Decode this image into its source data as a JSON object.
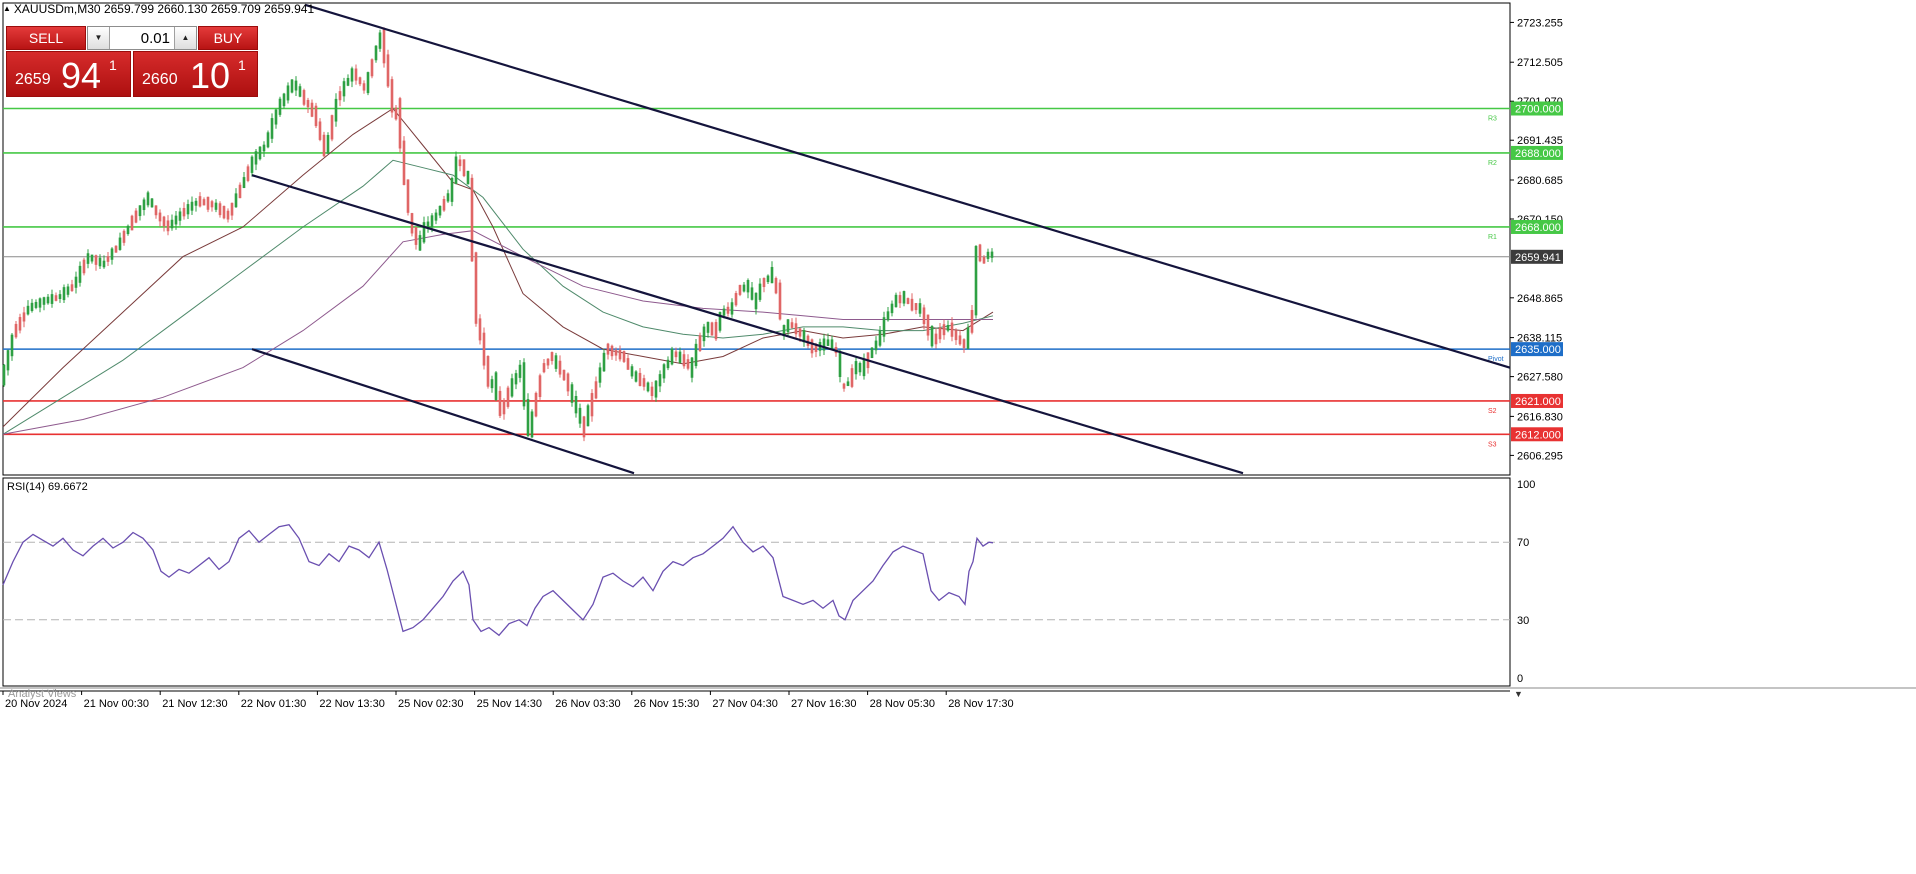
{
  "symbol": {
    "header": "XAUUSDm,M30  2659.799 2660.130 2659.709 2659.941",
    "collapse_icon": "triangle-up-icon"
  },
  "trade_panel": {
    "sell_label": "SELL",
    "buy_label": "BUY",
    "lot_value": "0.01",
    "lot_down_icon": "triangle-down-icon",
    "lot_up_icon": "triangle-up-icon",
    "bid_prefix": "2659",
    "bid_big": "94",
    "bid_sup": "1",
    "ask_prefix": "2660",
    "ask_big": "10",
    "ask_sup": "1",
    "color": "#c81e1e"
  },
  "chart_data": {
    "type": "candlestick",
    "symbol": "XAUUSDm",
    "timeframe": "M30",
    "price_axis": {
      "ylim": [
        2601.0,
        2728.5
      ],
      "ticks": [
        2723.255,
        2712.505,
        2701.97,
        2691.435,
        2680.685,
        2670.15,
        2659.941,
        2648.865,
        2638.115,
        2627.58,
        2616.83,
        2606.295
      ]
    },
    "current_price": {
      "value": 2659.941,
      "label": "2659.941",
      "color": "#3c3c3c"
    },
    "time_labels": [
      "20 Nov 2024",
      "21 Nov 00:30",
      "21 Nov 12:30",
      "22 Nov 01:30",
      "22 Nov 13:30",
      "25 Nov 02:30",
      "25 Nov 14:30",
      "26 Nov 03:30",
      "26 Nov 15:30",
      "27 Nov 04:30",
      "27 Nov 16:30",
      "28 Nov 05:30",
      "28 Nov 17:30"
    ],
    "close_path": [
      [
        0,
        2628
      ],
      [
        12,
        2640
      ],
      [
        25,
        2646
      ],
      [
        40,
        2648
      ],
      [
        55,
        2649
      ],
      [
        70,
        2652
      ],
      [
        85,
        2660
      ],
      [
        100,
        2658
      ],
      [
        115,
        2663
      ],
      [
        130,
        2670
      ],
      [
        145,
        2676
      ],
      [
        155,
        2671
      ],
      [
        165,
        2668
      ],
      [
        180,
        2672
      ],
      [
        195,
        2675
      ],
      [
        210,
        2674
      ],
      [
        225,
        2671
      ],
      [
        240,
        2680
      ],
      [
        250,
        2686
      ],
      [
        262,
        2690
      ],
      [
        275,
        2700
      ],
      [
        290,
        2707
      ],
      [
        300,
        2703
      ],
      [
        312,
        2698
      ],
      [
        322,
        2688
      ],
      [
        335,
        2703
      ],
      [
        350,
        2710
      ],
      [
        362,
        2705
      ],
      [
        372,
        2715
      ],
      [
        378,
        2720
      ],
      [
        383,
        2712
      ],
      [
        390,
        2700
      ],
      [
        396,
        2696
      ],
      [
        402,
        2680
      ],
      [
        408,
        2669
      ],
      [
        415,
        2663
      ],
      [
        422,
        2668
      ],
      [
        430,
        2670
      ],
      [
        440,
        2674
      ],
      [
        448,
        2678
      ],
      [
        454,
        2686
      ],
      [
        460,
        2684
      ],
      [
        466,
        2680
      ],
      [
        470,
        2660
      ],
      [
        474,
        2643
      ],
      [
        480,
        2635
      ],
      [
        486,
        2626
      ],
      [
        492,
        2625
      ],
      [
        498,
        2618
      ],
      [
        504,
        2622
      ],
      [
        510,
        2626
      ],
      [
        518,
        2630
      ],
      [
        526,
        2612
      ],
      [
        532,
        2620
      ],
      [
        540,
        2630
      ],
      [
        548,
        2633
      ],
      [
        556,
        2630
      ],
      [
        564,
        2626
      ],
      [
        572,
        2620
      ],
      [
        580,
        2614
      ],
      [
        588,
        2620
      ],
      [
        596,
        2628
      ],
      [
        604,
        2635
      ],
      [
        612,
        2634
      ],
      [
        620,
        2633
      ],
      [
        630,
        2628
      ],
      [
        640,
        2626
      ],
      [
        650,
        2623
      ],
      [
        660,
        2629
      ],
      [
        670,
        2634
      ],
      [
        680,
        2632
      ],
      [
        688,
        2630
      ],
      [
        695,
        2636
      ],
      [
        703,
        2641
      ],
      [
        712,
        2640
      ],
      [
        720,
        2645
      ],
      [
        728,
        2646
      ],
      [
        736,
        2651
      ],
      [
        744,
        2652
      ],
      [
        752,
        2648
      ],
      [
        760,
        2653
      ],
      [
        768,
        2655
      ],
      [
        775,
        2650
      ],
      [
        780,
        2640
      ],
      [
        786,
        2642
      ],
      [
        794,
        2640
      ],
      [
        802,
        2638
      ],
      [
        810,
        2635
      ],
      [
        818,
        2636
      ],
      [
        826,
        2637
      ],
      [
        834,
        2634
      ],
      [
        840,
        2625
      ],
      [
        846,
        2626
      ],
      [
        852,
        2630
      ],
      [
        860,
        2630
      ],
      [
        868,
        2634
      ],
      [
        876,
        2638
      ],
      [
        884,
        2644
      ],
      [
        892,
        2648
      ],
      [
        900,
        2649
      ],
      [
        908,
        2647
      ],
      [
        916,
        2646
      ],
      [
        922,
        2643
      ],
      [
        930,
        2637
      ],
      [
        938,
        2640
      ],
      [
        946,
        2641
      ],
      [
        954,
        2638
      ],
      [
        962,
        2636
      ],
      [
        966,
        2640
      ],
      [
        970,
        2645
      ],
      [
        974,
        2662
      ],
      [
        980,
        2659
      ],
      [
        986,
        2661
      ],
      [
        990,
        2660
      ]
    ],
    "moving_averages": [
      {
        "color": "#7a3b3b",
        "points": [
          [
            0,
            2614
          ],
          [
            60,
            2630
          ],
          [
            120,
            2645
          ],
          [
            180,
            2660
          ],
          [
            240,
            2668
          ],
          [
            300,
            2682
          ],
          [
            350,
            2693
          ],
          [
            390,
            2700
          ],
          [
            420,
            2690
          ],
          [
            450,
            2680
          ],
          [
            470,
            2678
          ],
          [
            490,
            2668
          ],
          [
            520,
            2650
          ],
          [
            560,
            2641
          ],
          [
            600,
            2635
          ],
          [
            640,
            2633
          ],
          [
            680,
            2631
          ],
          [
            720,
            2633
          ],
          [
            760,
            2638
          ],
          [
            800,
            2640
          ],
          [
            840,
            2638
          ],
          [
            880,
            2639
          ],
          [
            920,
            2641
          ],
          [
            960,
            2640
          ],
          [
            990,
            2645
          ]
        ]
      },
      {
        "color": "#4f8a6b",
        "points": [
          [
            0,
            2612
          ],
          [
            60,
            2622
          ],
          [
            120,
            2632
          ],
          [
            180,
            2644
          ],
          [
            240,
            2656
          ],
          [
            300,
            2668
          ],
          [
            360,
            2679
          ],
          [
            390,
            2686
          ],
          [
            420,
            2684
          ],
          [
            450,
            2682
          ],
          [
            480,
            2676
          ],
          [
            520,
            2662
          ],
          [
            560,
            2652
          ],
          [
            600,
            2645
          ],
          [
            640,
            2641
          ],
          [
            680,
            2639
          ],
          [
            720,
            2638
          ],
          [
            760,
            2639
          ],
          [
            800,
            2641
          ],
          [
            840,
            2641
          ],
          [
            880,
            2640
          ],
          [
            920,
            2640
          ],
          [
            960,
            2642
          ],
          [
            990,
            2644
          ]
        ]
      },
      {
        "color": "#8e5a8e",
        "points": [
          [
            0,
            2612
          ],
          [
            80,
            2616
          ],
          [
            160,
            2622
          ],
          [
            240,
            2630
          ],
          [
            300,
            2640
          ],
          [
            360,
            2652
          ],
          [
            400,
            2664
          ],
          [
            440,
            2666
          ],
          [
            470,
            2667
          ],
          [
            520,
            2660
          ],
          [
            580,
            2652
          ],
          [
            640,
            2648
          ],
          [
            700,
            2646
          ],
          [
            760,
            2645
          ],
          [
            800,
            2644
          ],
          [
            840,
            2643
          ],
          [
            880,
            2643
          ],
          [
            920,
            2643
          ],
          [
            960,
            2643
          ],
          [
            990,
            2643
          ]
        ]
      }
    ],
    "horizontal_levels": [
      {
        "value": 2700.0,
        "label": "2700.000",
        "tag": "R3",
        "color": "#46c846"
      },
      {
        "value": 2688.0,
        "label": "2688.000",
        "tag": "R2",
        "color": "#46c846"
      },
      {
        "value": 2668.0,
        "label": "2668.000",
        "tag": "R1",
        "color": "#46c846"
      },
      {
        "value": 2635.0,
        "label": "2635.000",
        "tag": "Pivot",
        "color": "#1e6ec8"
      },
      {
        "value": 2621.0,
        "label": "2621.000",
        "tag": "S2",
        "color": "#e83232"
      },
      {
        "value": 2612.0,
        "label": "2612.000",
        "tag": "S3",
        "color": "#e83232"
      }
    ],
    "trendlines": [
      {
        "color": "#14143c",
        "from": [
          305,
          2728.0
        ],
        "to": [
          1510,
          2630.0
        ]
      },
      {
        "color": "#14143c",
        "from": [
          252,
          2682.0
        ],
        "to": [
          1243,
          2601.5
        ]
      },
      {
        "color": "#14143c",
        "from": [
          252,
          2635.0
        ],
        "to": [
          634,
          2601.5
        ]
      }
    ],
    "candle_colors": {
      "bull": "#2ea043",
      "bear": "#e06666"
    },
    "rsi": {
      "label": "RSI(14) 69.6672",
      "ylim": [
        0,
        100
      ],
      "levels": [
        70,
        30
      ],
      "tick_labels": [
        "100",
        "70",
        "30",
        "0"
      ],
      "color": "#6a4fb0",
      "values": [
        [
          0,
          48
        ],
        [
          10,
          60
        ],
        [
          20,
          70
        ],
        [
          30,
          74
        ],
        [
          40,
          71
        ],
        [
          50,
          68
        ],
        [
          60,
          72
        ],
        [
          70,
          66
        ],
        [
          80,
          63
        ],
        [
          90,
          68
        ],
        [
          100,
          72
        ],
        [
          110,
          67
        ],
        [
          120,
          70
        ],
        [
          130,
          75
        ],
        [
          140,
          72
        ],
        [
          150,
          66
        ],
        [
          158,
          55
        ],
        [
          166,
          52
        ],
        [
          176,
          56
        ],
        [
          186,
          54
        ],
        [
          196,
          58
        ],
        [
          206,
          62
        ],
        [
          216,
          56
        ],
        [
          226,
          60
        ],
        [
          236,
          72
        ],
        [
          246,
          76
        ],
        [
          256,
          70
        ],
        [
          266,
          74
        ],
        [
          276,
          78
        ],
        [
          286,
          79
        ],
        [
          296,
          72
        ],
        [
          306,
          60
        ],
        [
          316,
          58
        ],
        [
          326,
          64
        ],
        [
          336,
          60
        ],
        [
          346,
          68
        ],
        [
          356,
          66
        ],
        [
          366,
          62
        ],
        [
          376,
          70
        ],
        [
          384,
          56
        ],
        [
          392,
          40
        ],
        [
          400,
          24
        ],
        [
          410,
          26
        ],
        [
          420,
          30
        ],
        [
          430,
          36
        ],
        [
          440,
          42
        ],
        [
          450,
          50
        ],
        [
          460,
          55
        ],
        [
          466,
          48
        ],
        [
          470,
          30
        ],
        [
          478,
          24
        ],
        [
          486,
          26
        ],
        [
          496,
          22
        ],
        [
          506,
          28
        ],
        [
          516,
          30
        ],
        [
          524,
          27
        ],
        [
          532,
          36
        ],
        [
          540,
          42
        ],
        [
          550,
          45
        ],
        [
          560,
          40
        ],
        [
          570,
          35
        ],
        [
          580,
          30
        ],
        [
          590,
          38
        ],
        [
          600,
          52
        ],
        [
          610,
          54
        ],
        [
          620,
          50
        ],
        [
          630,
          47
        ],
        [
          640,
          52
        ],
        [
          650,
          45
        ],
        [
          660,
          55
        ],
        [
          670,
          60
        ],
        [
          680,
          58
        ],
        [
          690,
          62
        ],
        [
          700,
          64
        ],
        [
          710,
          68
        ],
        [
          720,
          72
        ],
        [
          730,
          78
        ],
        [
          740,
          70
        ],
        [
          750,
          65
        ],
        [
          760,
          68
        ],
        [
          770,
          62
        ],
        [
          780,
          42
        ],
        [
          790,
          40
        ],
        [
          800,
          38
        ],
        [
          810,
          40
        ],
        [
          820,
          36
        ],
        [
          830,
          40
        ],
        [
          836,
          32
        ],
        [
          842,
          30
        ],
        [
          850,
          40
        ],
        [
          860,
          45
        ],
        [
          870,
          50
        ],
        [
          880,
          58
        ],
        [
          890,
          65
        ],
        [
          900,
          68
        ],
        [
          910,
          66
        ],
        [
          920,
          64
        ],
        [
          928,
          45
        ],
        [
          936,
          40
        ],
        [
          946,
          44
        ],
        [
          956,
          42
        ],
        [
          962,
          38
        ],
        [
          966,
          55
        ],
        [
          970,
          60
        ],
        [
          974,
          72
        ],
        [
          980,
          68
        ],
        [
          986,
          70
        ],
        [
          990,
          69.67
        ]
      ]
    },
    "footer_caption": "Analyst Views"
  }
}
